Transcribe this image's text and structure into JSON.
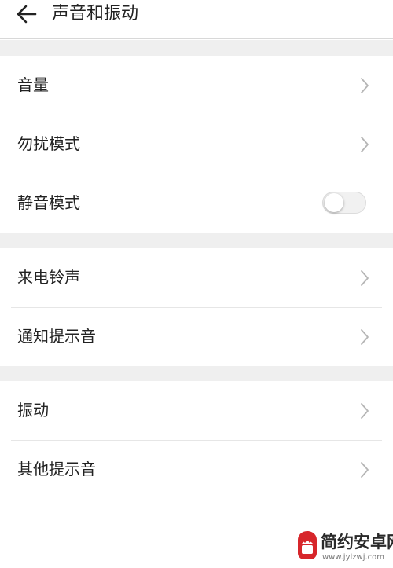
{
  "header": {
    "back_icon": "arrow-left-icon",
    "title": "声音和振动"
  },
  "groups": [
    {
      "items": [
        {
          "label": "音量",
          "control": "chevron"
        },
        {
          "label": "勿扰模式",
          "control": "chevron"
        },
        {
          "label": "静音模式",
          "control": "toggle",
          "toggle_on": false
        }
      ]
    },
    {
      "items": [
        {
          "label": "来电铃声",
          "control": "chevron"
        },
        {
          "label": "通知提示音",
          "control": "chevron"
        }
      ]
    },
    {
      "items": [
        {
          "label": "振动",
          "control": "chevron"
        },
        {
          "label": "其他提示音",
          "control": "chevron"
        }
      ]
    }
  ],
  "watermark": {
    "name": "简约安卓网",
    "url": "www.jylzwj.com"
  },
  "colors": {
    "background": "#ffffff",
    "section_gap": "#efefef",
    "text": "#222222",
    "chevron": "#b5b5b5",
    "divider": "#e6e6e6",
    "watermark_red": "#d7262b"
  }
}
